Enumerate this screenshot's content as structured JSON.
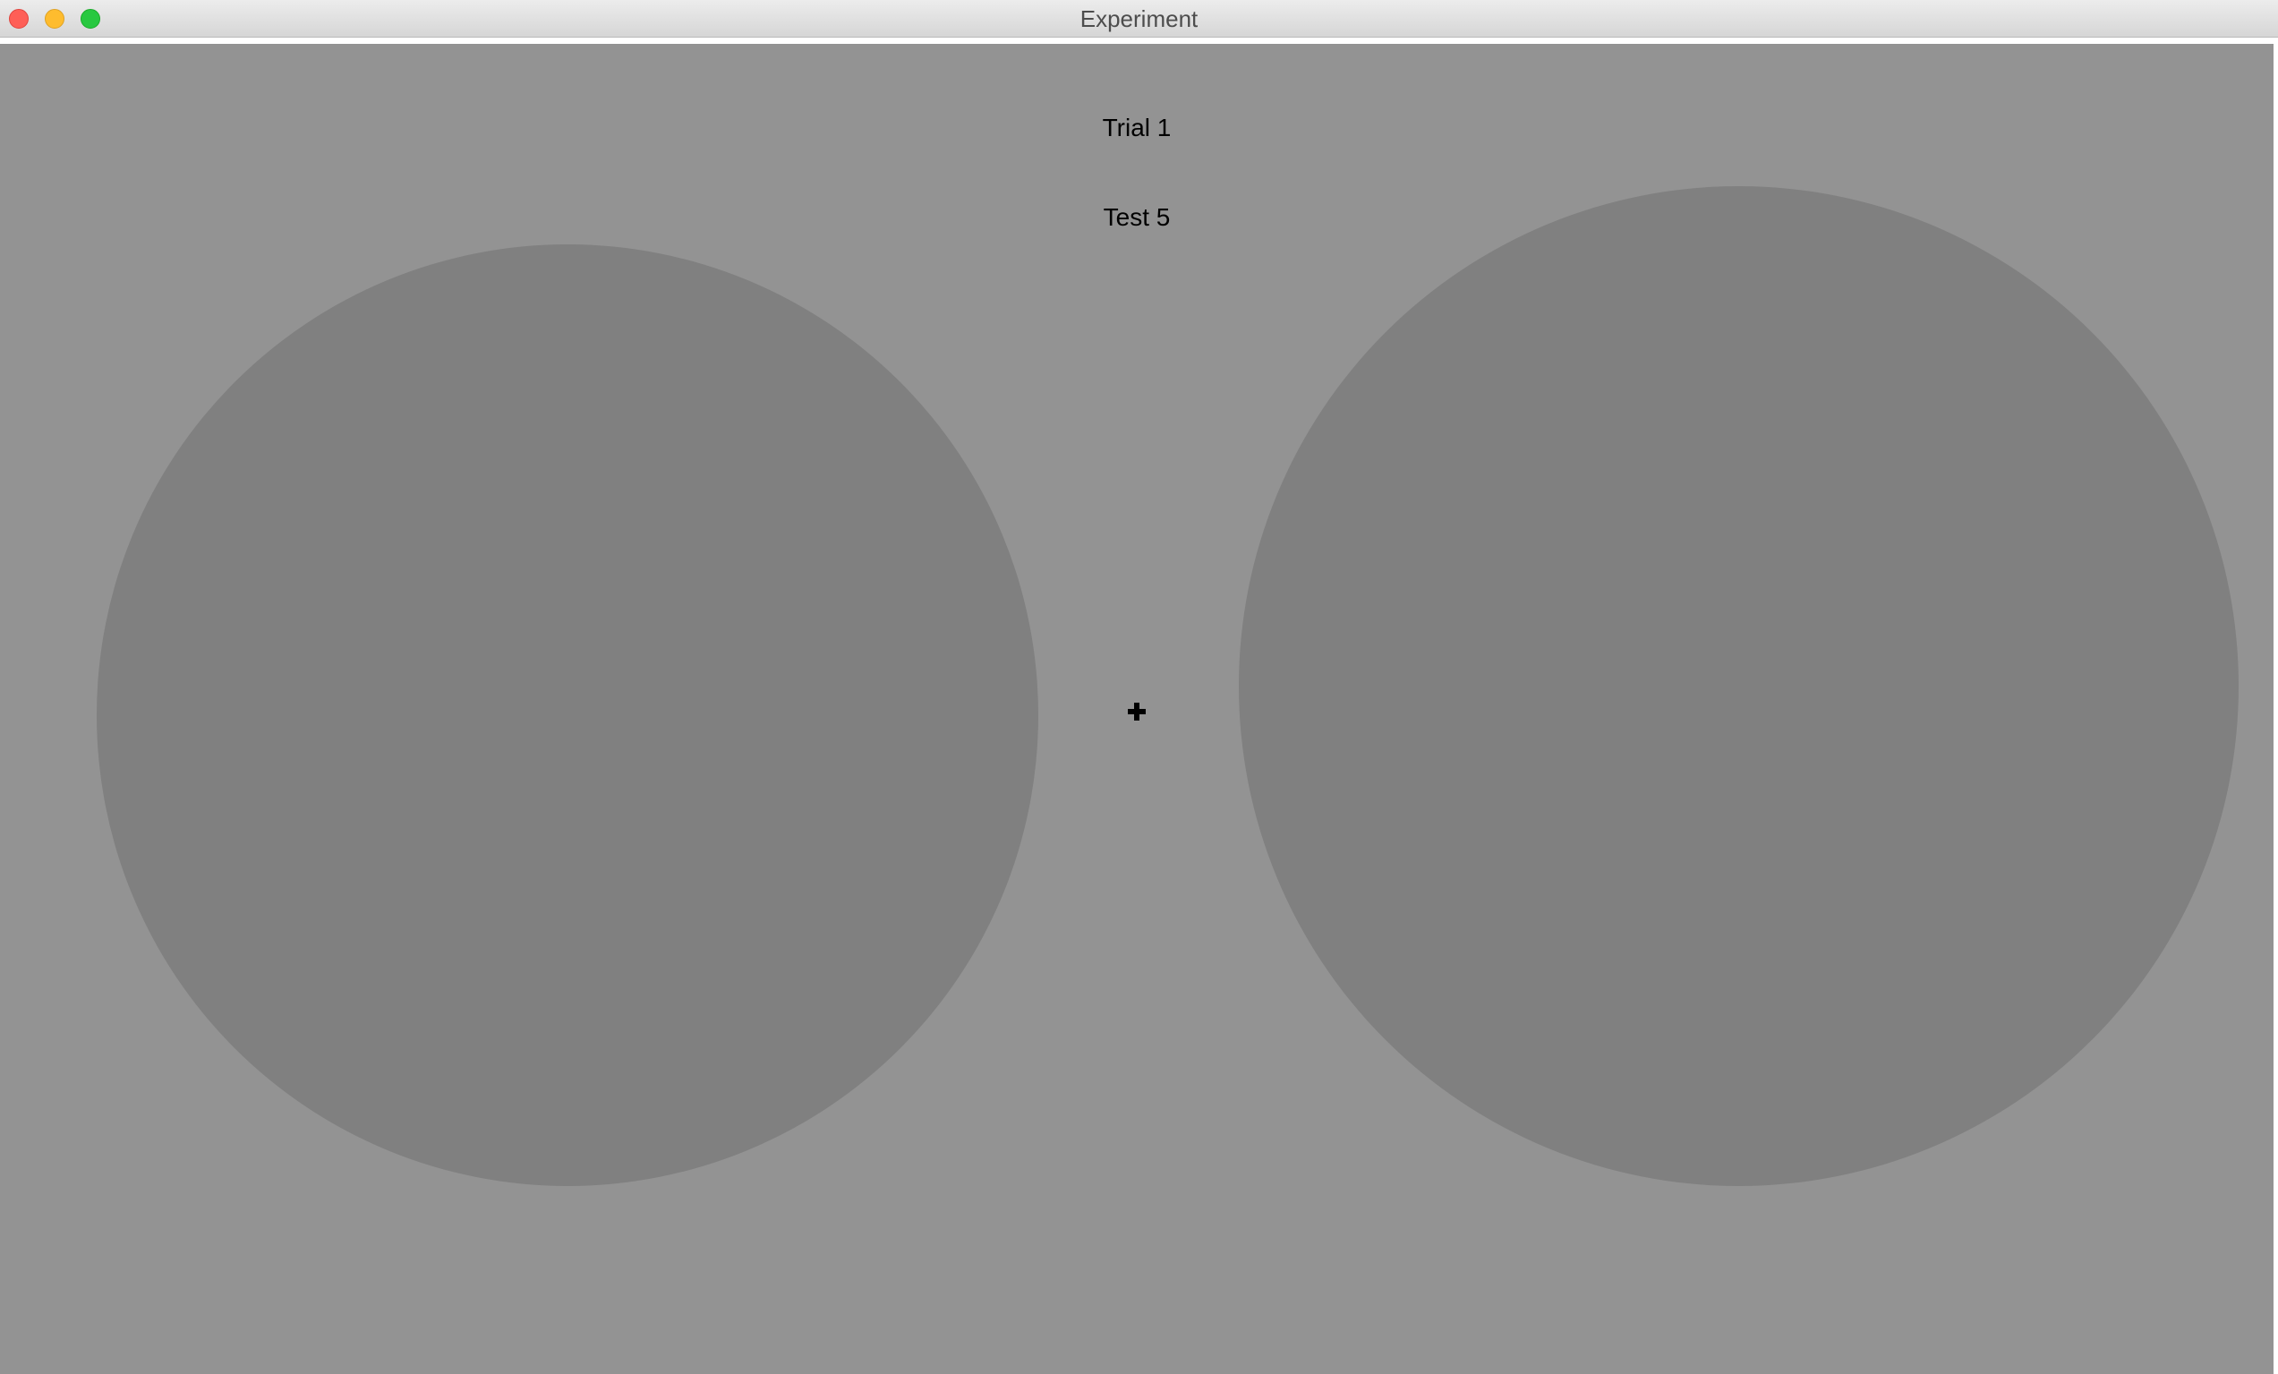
{
  "window": {
    "title": "Experiment",
    "controls": {
      "close_icon": "close-icon",
      "minimize_icon": "minimize-icon",
      "maximize_icon": "maximize-icon"
    }
  },
  "experiment": {
    "trial_label": "Trial 1",
    "test_label": "Test 5",
    "fixation_icon": "plus-icon",
    "background_color": "#939393",
    "stimulus_color": "#808080"
  }
}
